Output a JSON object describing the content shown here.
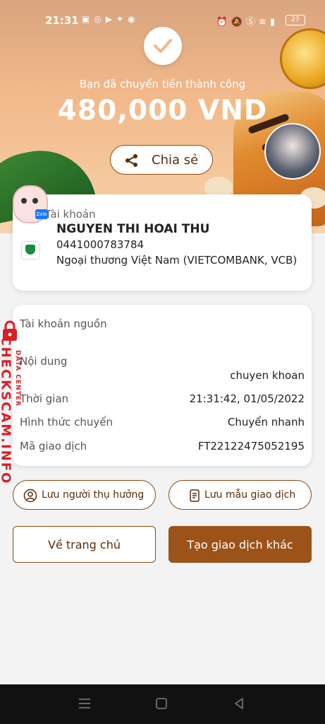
{
  "status_bar": {
    "time": "21:31",
    "battery": "27"
  },
  "hero": {
    "success_text": "Bạn đã chuyển tiền thành công",
    "amount": "480,000 VND",
    "share_label": "Chia sẻ"
  },
  "recipient": {
    "label": "Tài khoản",
    "name": "NGUYEN THI HOAI THU",
    "account_number": "0441000783784",
    "bank": "Ngoại thương Việt Nam (VIETCOMBANK, VCB)"
  },
  "details": {
    "source_label": "Tài khoản nguồn",
    "content_label": "Nội dung",
    "content_value": "chuyen khoan",
    "time_label": "Thời gian",
    "time_value": "21:31:42, 01/05/2022",
    "method_label": "Hình thức chuyển",
    "method_value": "Chuyển nhanh",
    "txn_label": "Mã giao dịch",
    "txn_value": "FT22122475052195"
  },
  "actions": {
    "save_beneficiary": "Lưu người thụ hưởng",
    "save_template": "Lưu mẫu giao dịch",
    "home": "Về trang chủ",
    "new_transaction": "Tạo giao dịch khác"
  },
  "watermark": {
    "main": "CHECKSCAM.INFO",
    "sub": "DATA CENTER"
  },
  "colors": {
    "brand_brown": "#9b5319",
    "vcb_green": "#1a8a3c",
    "watermark_red": "#d91e26"
  }
}
